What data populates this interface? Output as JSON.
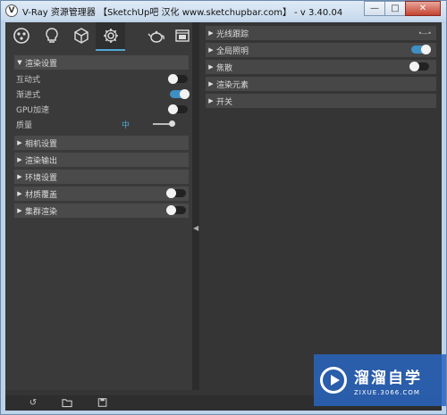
{
  "window": {
    "title": "V-Ray 资源管理器 【SketchUp吧 汉化 www.sketchupbar.com】 - v 3.40.04",
    "app_icon": "vray-logo",
    "minimize_label": "—",
    "maximize_label": "□",
    "close_label": "✕"
  },
  "toolbar": {
    "tabs": [
      {
        "name": "materials-tab",
        "icon": "material-sphere-icon"
      },
      {
        "name": "lights-tab",
        "icon": "light-bulb-icon"
      },
      {
        "name": "geometry-tab",
        "icon": "cube-icon"
      },
      {
        "name": "settings-tab",
        "icon": "gear-icon",
        "active": true
      },
      {
        "name": "render-tab",
        "icon": "teapot-icon"
      },
      {
        "name": "frame-buffer-tab",
        "icon": "frame-buffer-icon"
      }
    ]
  },
  "left_panel": {
    "render_settings": {
      "label": "渲染设置",
      "interactive": {
        "label": "互动式",
        "on": false
      },
      "progressive": {
        "label": "渐进式",
        "on": true
      },
      "gpu": {
        "label": "GPU加速",
        "on": false
      },
      "quality": {
        "label": "质量",
        "value": "中",
        "level": 0.85
      }
    },
    "sections": [
      {
        "label": "相机设置"
      },
      {
        "label": "渲染输出"
      },
      {
        "label": "环境设置"
      },
      {
        "label": "材质覆盖",
        "toggle": false
      },
      {
        "label": "集群渲染",
        "toggle": false
      }
    ]
  },
  "right_panel": {
    "sections": [
      {
        "label": "光线跟踪",
        "has_menu": true
      },
      {
        "label": "全局照明",
        "toggle": true
      },
      {
        "label": "焦散",
        "toggle": false
      },
      {
        "label": "渲染元素"
      },
      {
        "label": "开关"
      }
    ]
  },
  "bottom_bar": {
    "icons": [
      "revert-icon",
      "open-folder-icon",
      "save-icon"
    ]
  },
  "watermark": {
    "title": "溜溜自学",
    "subtitle": "ZIXUE.3066.COM"
  },
  "colors": {
    "accent": "#4fa8d6",
    "panel_bg": "#3a3a3a",
    "header_bg": "#4a4a4a"
  }
}
